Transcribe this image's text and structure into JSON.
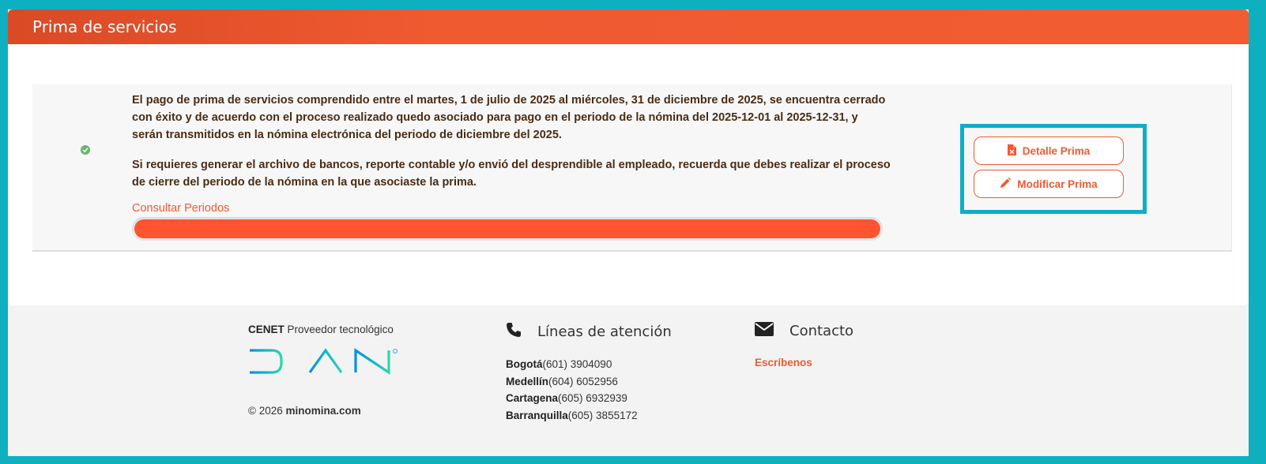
{
  "header": {
    "title": "Prima de servicios"
  },
  "notice": {
    "paragraph1": "El pago de prima de servicios comprendido entre el martes, 1 de julio de 2025 al miércoles, 31 de diciembre de 2025, se encuentra cerrado con éxito y de acuerdo con el proceso realizado quedo asociado para pago en el periodo de la nómina del 2025-12-01 al 2025-12-31, y serán transmitidos en la nómina electrónica del periodo de diciembre del 2025.",
    "paragraph2": "Si requieres generar el archivo de bancos, reporte contable y/o envió del desprendible al empleado, recuerda que debes realizar el proceso de cierre del periodo de la nómina en la que asociaste la prima.",
    "consult_link": "Consultar Periodos",
    "progress_fraction": 1.0,
    "status_icon": "check-circle-icon"
  },
  "actions": {
    "detail_label": "Detalle Prima",
    "detail_icon": "excel-file-icon",
    "modify_label": "Modificar Prima",
    "modify_icon": "pencil-icon"
  },
  "footer": {
    "provider_brand": "CENET",
    "provider_text": " Proveedor tecnológico",
    "logo_text": "DIAN",
    "copyright_prefix": "© 2026 ",
    "copyright_site": "minomina.com",
    "lines_title": "Líneas de atención",
    "lines": [
      {
        "city": "Bogotá",
        "phone": "(601) 3904090"
      },
      {
        "city": "Medellín",
        "phone": "(604) 6052956"
      },
      {
        "city": "Cartagena",
        "phone": "(605) 6932939"
      },
      {
        "city": "Barranquilla",
        "phone": "(605) 3855172"
      }
    ],
    "contact_title": "Contacto",
    "contact_link": "Escríbenos"
  },
  "colors": {
    "accent": "#f05a31",
    "frame": "#0eb0c0",
    "success": "#6ab56e"
  }
}
